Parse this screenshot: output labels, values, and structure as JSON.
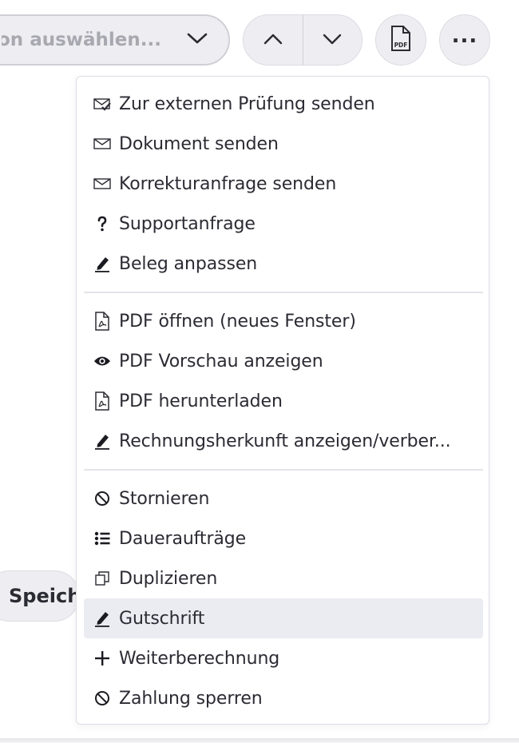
{
  "toolbar": {
    "select_text": "ion auswählen...",
    "pdf_label": "PDF"
  },
  "side": {
    "save_label": "Speich"
  },
  "menu": {
    "group1": [
      {
        "label": "Zur externen Prüfung senden",
        "icon": "envelope-check-icon"
      },
      {
        "label": "Dokument senden",
        "icon": "envelope-icon"
      },
      {
        "label": "Korrekturanfrage senden",
        "icon": "envelope-icon"
      },
      {
        "label": "Supportanfrage",
        "icon": "question-icon"
      },
      {
        "label": "Beleg anpassen",
        "icon": "pencil-icon"
      }
    ],
    "group2": [
      {
        "label": "PDF öffnen (neues Fenster)",
        "icon": "pdf-file-icon"
      },
      {
        "label": "PDF Vorschau anzeigen",
        "icon": "eye-icon"
      },
      {
        "label": "PDF herunterladen",
        "icon": "pdf-file-icon"
      },
      {
        "label": "Rechnungsherkunft anzeigen/verber...",
        "icon": "pencil-icon"
      }
    ],
    "group3": [
      {
        "label": "Stornieren",
        "icon": "ban-icon"
      },
      {
        "label": "Daueraufträge",
        "icon": "list-icon"
      },
      {
        "label": "Duplizieren",
        "icon": "copy-icon"
      },
      {
        "label": "Gutschrift",
        "icon": "pencil-icon",
        "active": true
      },
      {
        "label": "Weiterberechnung",
        "icon": "plus-icon"
      },
      {
        "label": "Zahlung sperren",
        "icon": "ban-icon"
      }
    ]
  },
  "colors": {
    "active_bg": "#ebebf2",
    "button_bg": "#eeeef2",
    "text": "#2b2b33"
  }
}
